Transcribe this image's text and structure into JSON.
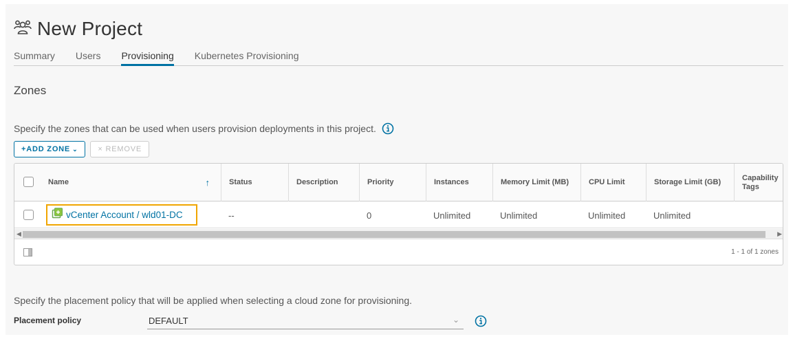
{
  "header": {
    "title": "New Project",
    "icon": "users-group-icon"
  },
  "tabs": [
    {
      "label": "Summary",
      "active": false
    },
    {
      "label": "Users",
      "active": false
    },
    {
      "label": "Provisioning",
      "active": true
    },
    {
      "label": "Kubernetes Provisioning",
      "active": false
    }
  ],
  "zones": {
    "title": "Zones",
    "description": "Specify the zones that can be used when users provision deployments in this project.",
    "add_label": "+ADD ZONE",
    "remove_label": "× REMOVE",
    "columns": [
      "Name",
      "Status",
      "Description",
      "Priority",
      "Instances",
      "Memory Limit (MB)",
      "CPU Limit",
      "Storage Limit (GB)",
      "Capability Tags"
    ],
    "sort_indicator": "↑",
    "rows": [
      {
        "name": "vCenter Account / wld01-DC",
        "status": "--",
        "description": "",
        "priority": "0",
        "instances": "Unlimited",
        "memory": "Unlimited",
        "cpu": "Unlimited",
        "storage": "Unlimited",
        "tags": ""
      }
    ],
    "pagination": "1 - 1 of 1 zones"
  },
  "placement": {
    "description": "Specify the placement policy that will be applied when selecting a cloud zone for provisioning.",
    "label": "Placement policy",
    "value": "DEFAULT"
  },
  "colors": {
    "accent": "#0072a3",
    "highlight": "#f0a500",
    "zone_icon": "#8cc63f"
  }
}
